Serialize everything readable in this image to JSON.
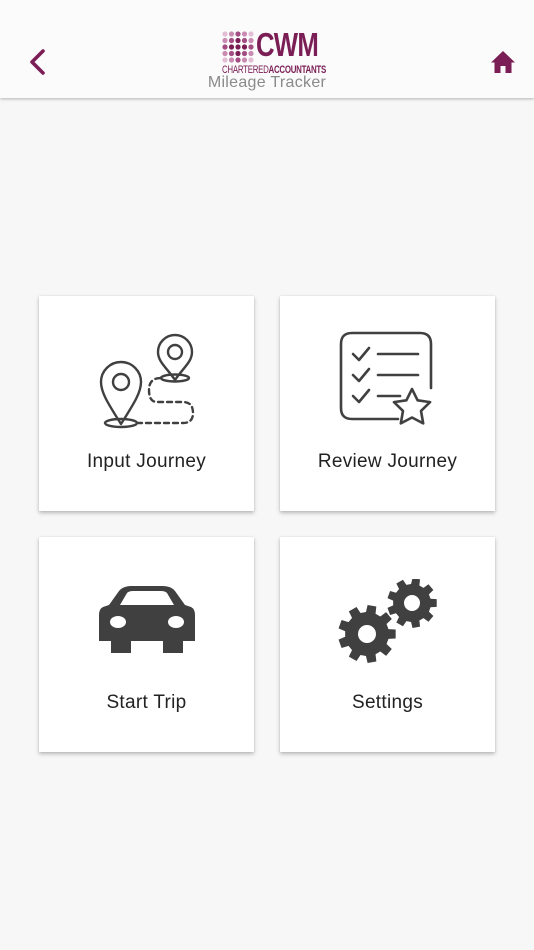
{
  "header": {
    "logo": {
      "brand": "CWM",
      "subtitle_chartered": "CHARTERED",
      "subtitle_accountants": "ACCOUNTANTS"
    },
    "app_title": "Mileage Tracker",
    "back_icon": "chevron-left-icon",
    "home_icon": "home-icon"
  },
  "colors": {
    "brand": "#7b1e56",
    "icon": "#404040",
    "background": "#f7f7f7",
    "card": "#ffffff"
  },
  "menu": [
    {
      "label": "Input Journey",
      "icon": "map-route-icon"
    },
    {
      "label": "Review Journey",
      "icon": "checklist-star-icon"
    },
    {
      "label": "Start Trip",
      "icon": "car-icon"
    },
    {
      "label": "Settings",
      "icon": "gears-icon"
    }
  ]
}
